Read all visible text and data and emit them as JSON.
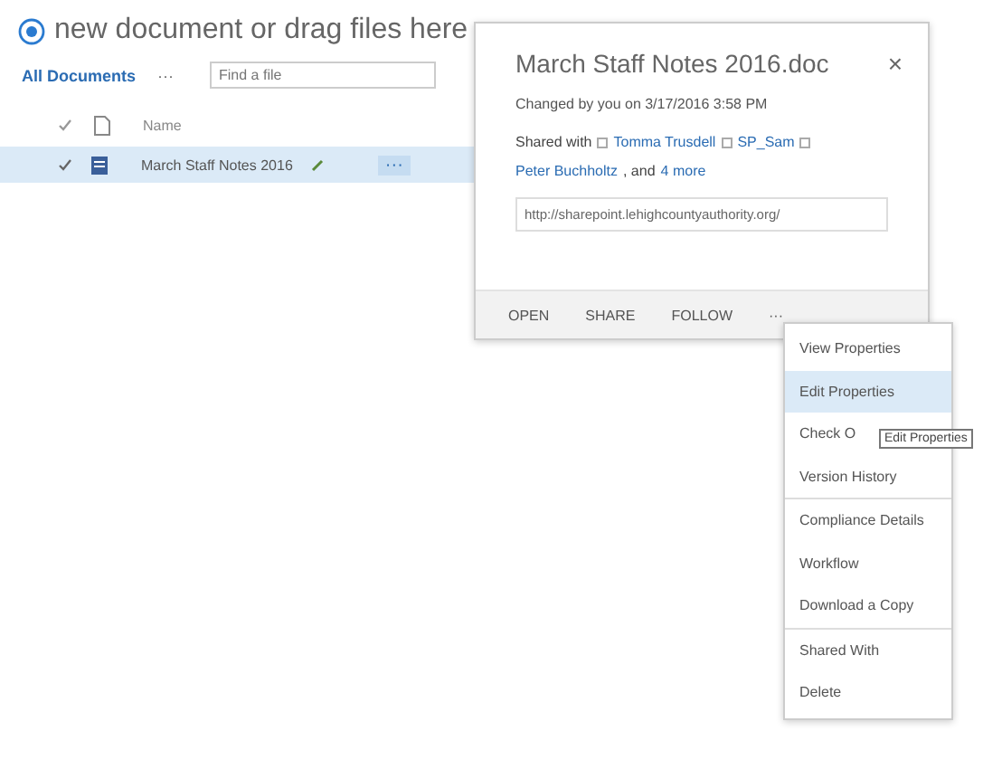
{
  "upload_bar": {
    "label": "new document or drag files here"
  },
  "views": {
    "current": "All Documents",
    "more": "···",
    "search": {
      "placeholder": "Find a file"
    }
  },
  "table": {
    "columns": [
      "Name"
    ],
    "rows": [
      {
        "name": "March Staff Notes 2016",
        "selected": true,
        "more": "···"
      }
    ]
  },
  "callout": {
    "title": "March Staff Notes 2016.doc",
    "close": "×",
    "changed": "Changed by you on 3/17/2016 3:58 PM",
    "shared_label": "Shared with",
    "shared_people": [
      "Tomma Trusdell",
      "SP_Sam",
      "Peter Buchholtz"
    ],
    "shared_and": ", and",
    "shared_more": "4 more",
    "url": "http://sharepoint.lehighcountyauthority.org/",
    "actions": [
      "OPEN",
      "SHARE",
      "FOLLOW"
    ],
    "more": "···"
  },
  "menu": {
    "items": [
      {
        "label": "View Properties",
        "selected": false,
        "separator_after": false
      },
      {
        "label": "Edit Properties",
        "selected": true,
        "separator_after": false
      },
      {
        "label": "Check O",
        "selected": false,
        "separator_after": false
      },
      {
        "label": "Version History",
        "selected": false,
        "separator_after": true
      },
      {
        "label": "Compliance Details",
        "selected": false,
        "separator_after": false
      },
      {
        "label": "Workflow",
        "selected": false,
        "separator_after": false
      },
      {
        "label": "Download a Copy",
        "selected": false,
        "separator_after": true
      },
      {
        "label": "Shared With",
        "selected": false,
        "separator_after": false
      },
      {
        "label": "Delete",
        "selected": false,
        "separator_after": false
      }
    ]
  },
  "tooltip": {
    "text": "Edit Properties"
  }
}
